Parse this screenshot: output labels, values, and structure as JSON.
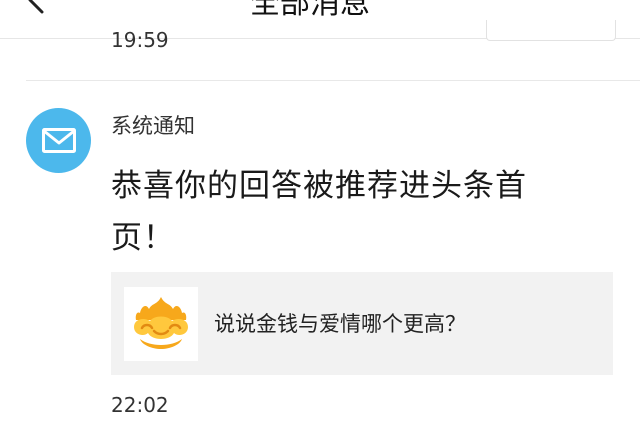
{
  "header": {
    "title": "全部消息",
    "title_arrow": "˅"
  },
  "previous_message": {
    "time": "19:59"
  },
  "message": {
    "sender": "系统通知",
    "text": "恭喜你的回答被推荐进头条首页！",
    "card": {
      "title": "说说金钱与爱情哪个更高？"
    },
    "time": "22:02"
  },
  "icons": {
    "back": "back-chevron-icon",
    "avatar": "mail-envelope-icon",
    "card_thumb": "golden-cloud-logo-icon"
  },
  "colors": {
    "avatar_bg": "#4cb8ec",
    "card_bg": "#f2f2f2",
    "logo_orange": "#f5a623",
    "logo_yellow": "#ffd24a"
  }
}
